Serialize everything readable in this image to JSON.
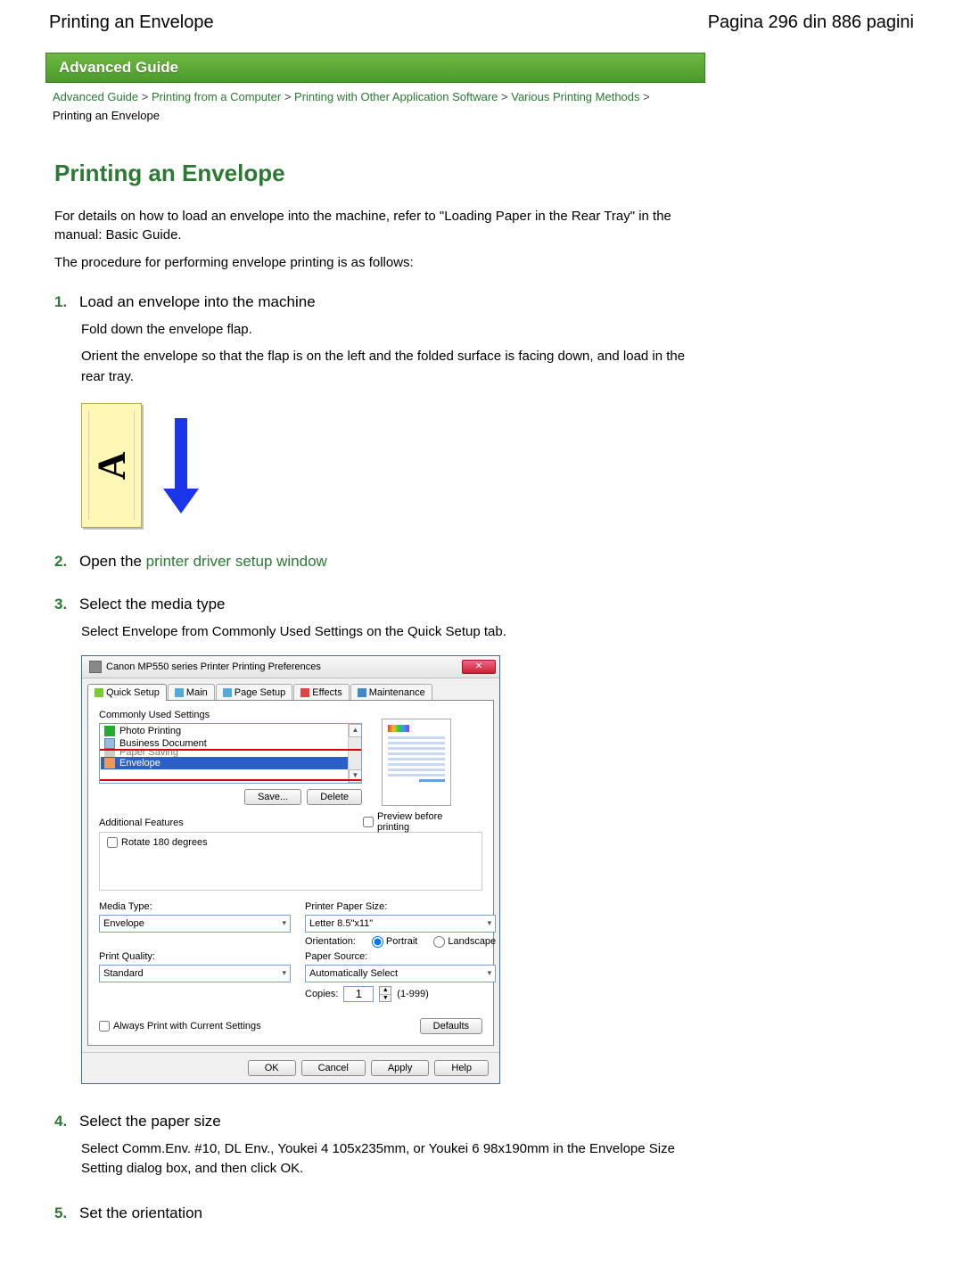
{
  "header": {
    "left": "Printing an Envelope",
    "right": "Pagina 296 din 886 pagini"
  },
  "advanced_guide_bar": "Advanced Guide",
  "breadcrumb": {
    "items": [
      "Advanced Guide",
      "Printing from a Computer",
      "Printing with Other Application Software",
      "Various Printing Methods"
    ],
    "current": "Printing an Envelope",
    "sep": ">"
  },
  "title": "Printing an Envelope",
  "intro1": "For details on how to load an envelope into the machine, refer to \"Loading Paper in the Rear Tray\" in the manual: Basic Guide.",
  "intro2": "The procedure for performing envelope printing is as follows:",
  "steps": {
    "s1": {
      "num": "1.",
      "title": "Load an envelope into the machine",
      "body1": "Fold down the envelope flap.",
      "body2": "Orient the envelope so that the flap is on the left and the folded surface is facing down, and load in the rear tray."
    },
    "s2": {
      "num": "2.",
      "title_prefix": "Open the ",
      "link": "printer driver setup window"
    },
    "s3": {
      "num": "3.",
      "title": "Select the media type",
      "body": "Select Envelope from Commonly Used Settings on the Quick Setup tab."
    },
    "s4": {
      "num": "4.",
      "title": "Select the paper size",
      "body": "Select Comm.Env. #10, DL Env., Youkei 4 105x235mm, or Youkei 6 98x190mm in the Envelope Size Setting dialog box, and then click OK."
    },
    "s5": {
      "num": "5.",
      "title": "Set the orientation"
    }
  },
  "envelope_letter": "A",
  "dialog": {
    "title": "Canon MP550 series Printer Printing Preferences",
    "tabs": [
      "Quick Setup",
      "Main",
      "Page Setup",
      "Effects",
      "Maintenance"
    ],
    "commonly_used_label": "Commonly Used Settings",
    "items": {
      "photo": "Photo Printing",
      "business": "Business Document",
      "paper_saving": "Paper Saving",
      "envelope": "Envelope"
    },
    "save_btn": "Save...",
    "delete_btn": "Delete",
    "preview_chk": "Preview before printing",
    "features_label": "Additional Features",
    "rotate_chk": "Rotate 180 degrees",
    "media_type_label": "Media Type:",
    "media_type_value": "Envelope",
    "paper_size_label": "Printer Paper Size:",
    "paper_size_value": "Letter 8.5\"x11\"",
    "orientation_label": "Orientation:",
    "orientation_portrait": "Portrait",
    "orientation_landscape": "Landscape",
    "print_quality_label": "Print Quality:",
    "print_quality_value": "Standard",
    "paper_source_label": "Paper Source:",
    "paper_source_value": "Automatically Select",
    "copies_label": "Copies:",
    "copies_value": "1",
    "copies_range": "(1-999)",
    "always_print_chk": "Always Print with Current Settings",
    "defaults_btn": "Defaults",
    "ok_btn": "OK",
    "cancel_btn": "Cancel",
    "apply_btn": "Apply",
    "help_btn": "Help"
  }
}
